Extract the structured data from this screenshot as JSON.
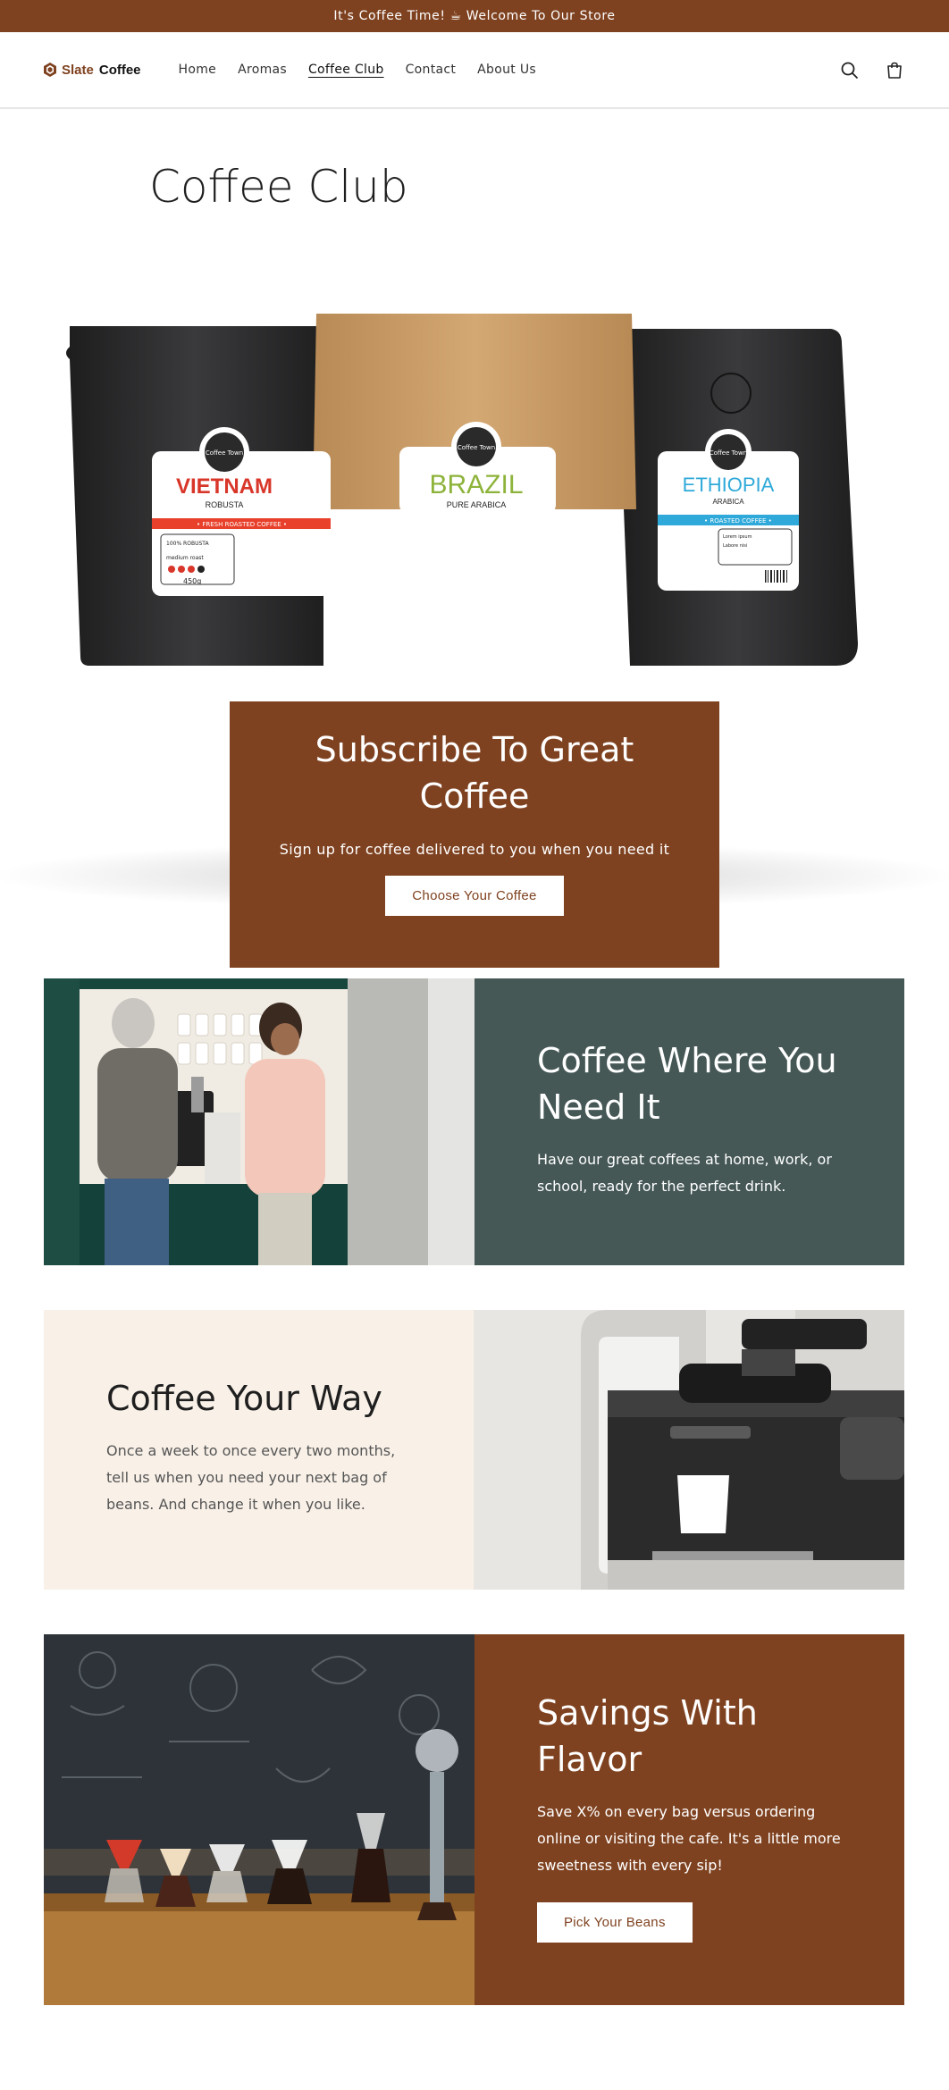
{
  "announcement": "It's Coffee Time! ☕ Welcome To Our Store",
  "header": {
    "logo_brand": "Slate",
    "logo_name": "Coffee",
    "nav": [
      {
        "label": "Home"
      },
      {
        "label": "Aromas"
      },
      {
        "label": "Coffee Club"
      },
      {
        "label": "Contact"
      },
      {
        "label": "About Us"
      }
    ],
    "active_nav": "Coffee Club",
    "icons": [
      "search-icon",
      "cart-icon"
    ]
  },
  "page_title": "Coffee Club",
  "hero": {
    "bags": [
      {
        "stamp": "Coffee Town",
        "origin": "VIETNAM",
        "variety": "ROBUSTA",
        "strip": "• FRESH ROASTED COFFEE •",
        "strip_color": "#e8402b",
        "origin_color": "#d9362a",
        "detail_1": "100% ROBUSTA",
        "detail_2": "medium roast",
        "weight": "450g"
      },
      {
        "stamp": "Coffee Town",
        "origin": "BRAZIL",
        "variety": "PURE ARABICA",
        "origin_color": "#8db33a"
      },
      {
        "stamp": "Coffee Town",
        "origin": "ETHIOPIA",
        "variety": "ARABICA",
        "strip": "• ROASTED COFFEE •",
        "strip_color": "#2fa9d9",
        "origin_color": "#2fa9d9",
        "detail_1": "Lorem ipsum",
        "detail_2": "Labore nisi"
      }
    ],
    "heading": "Subscribe To Great Coffee",
    "subtext": "Sign up for coffee delivered to you when you need it",
    "button": "Choose Your Coffee"
  },
  "features": [
    {
      "heading": "Coffee Where You Need It",
      "text": "Have our great coffees at home, work, or school, ready for the perfect drink.",
      "bg": "#455856"
    },
    {
      "heading": "Coffee Your Way",
      "text": "Once a week to once every two months, tell us when you need your next bag of beans. And change it when you like.",
      "bg": "#f9f1e8"
    },
    {
      "heading": "Savings With Flavor",
      "text": "Save X% on every bag versus ordering online or visiting the cafe. It's a little more sweetness with every sip!",
      "button": "Pick Your Beans",
      "bg": "#7f4220"
    }
  ],
  "colors": {
    "brand": "#7f4220",
    "slate": "#455856",
    "cream": "#f9f1e8"
  }
}
